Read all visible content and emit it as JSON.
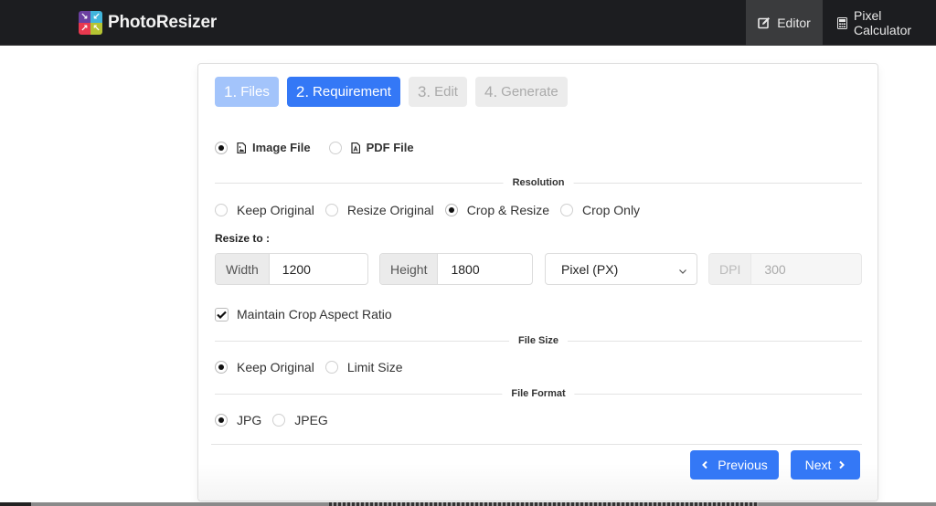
{
  "app": {
    "brand_name": "PhotoResizer",
    "logo_colors": [
      "#6b3fa0",
      "#41b5dc",
      "#e8384f",
      "#b5c433"
    ]
  },
  "navbar": {
    "items": [
      {
        "label": "Editor",
        "icon": "edit-icon",
        "active": true
      },
      {
        "label": "Pixel Calculator",
        "icon": "calculator-icon",
        "active": false
      }
    ]
  },
  "steps": [
    {
      "num": "1.",
      "label": "Files",
      "state": "done"
    },
    {
      "num": "2.",
      "label": "Requirement",
      "state": "active"
    },
    {
      "num": "3.",
      "label": "Edit",
      "state": "pending"
    },
    {
      "num": "4.",
      "label": "Generate",
      "state": "pending"
    }
  ],
  "file_type": {
    "options": [
      {
        "label": "Image File",
        "icon": "image-file-icon",
        "selected": true
      },
      {
        "label": "PDF File",
        "icon": "pdf-file-icon",
        "selected": false
      }
    ]
  },
  "resolution": {
    "title": "Resolution",
    "options": [
      {
        "label": "Keep Original",
        "selected": false
      },
      {
        "label": "Resize Original",
        "selected": false
      },
      {
        "label": "Crop & Resize",
        "selected": true
      },
      {
        "label": "Crop Only",
        "selected": false
      }
    ],
    "resize_label": "Resize to :",
    "width_label": "Width",
    "width_value": "1200",
    "height_label": "Height",
    "height_value": "1800",
    "unit_selected": "Pixel (PX)",
    "dpi_label": "DPI",
    "dpi_value": "300",
    "maintain_aspect_label": "Maintain Crop Aspect Ratio",
    "maintain_aspect_checked": true
  },
  "file_size": {
    "title": "File Size",
    "options": [
      {
        "label": "Keep Original",
        "selected": true
      },
      {
        "label": "Limit Size",
        "selected": false
      }
    ]
  },
  "file_format": {
    "title": "File Format",
    "options": [
      {
        "label": "JPG",
        "selected": true
      },
      {
        "label": "JPEG",
        "selected": false
      }
    ]
  },
  "buttons": {
    "previous": "Previous",
    "next": "Next"
  },
  "colors": {
    "primary": "#3478f6",
    "primary_light": "#a3c4fb",
    "navbar_bg": "#1c1d20"
  }
}
